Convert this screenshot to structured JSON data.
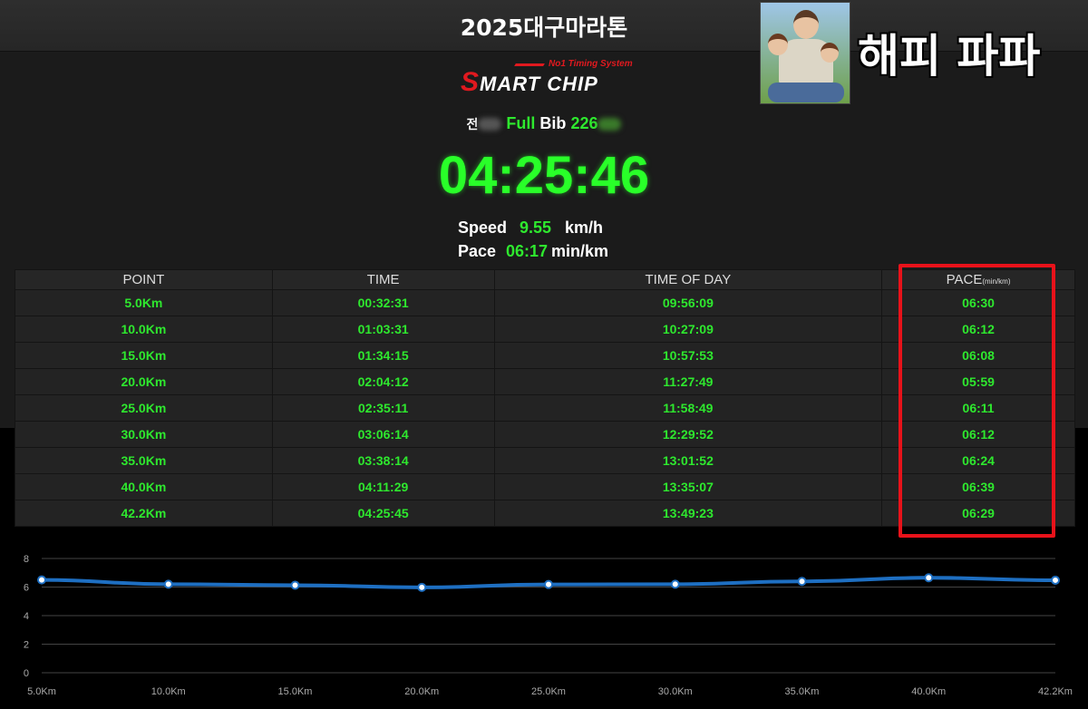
{
  "header": {
    "title": "2025대구마라톤"
  },
  "logo": {
    "tagline": "No1 Timing System",
    "brand_s": "S",
    "brand_rest": "MART CHIP"
  },
  "runner": {
    "name_visible": "전",
    "category": "Full",
    "bib_label": "Bib",
    "bib_visible": "226"
  },
  "result": {
    "finish_time": "04:25:46"
  },
  "stats": {
    "speed_label": "Speed",
    "speed_value": "9.55",
    "speed_unit": "km/h",
    "pace_label": "Pace",
    "pace_value": "06:17",
    "pace_unit": "min/km"
  },
  "splits": {
    "headers": [
      "POINT",
      "TIME",
      "TIME OF DAY",
      "PACE"
    ],
    "pace_unit_small": "(min/km)",
    "rows": [
      [
        "5.0Km",
        "00:32:31",
        "09:56:09",
        "06:30"
      ],
      [
        "10.0Km",
        "01:03:31",
        "10:27:09",
        "06:12"
      ],
      [
        "15.0Km",
        "01:34:15",
        "10:57:53",
        "06:08"
      ],
      [
        "20.0Km",
        "02:04:12",
        "11:27:49",
        "05:59"
      ],
      [
        "25.0Km",
        "02:35:11",
        "11:58:49",
        "06:11"
      ],
      [
        "30.0Km",
        "03:06:14",
        "12:29:52",
        "06:12"
      ],
      [
        "35.0Km",
        "03:38:14",
        "13:01:52",
        "06:24"
      ],
      [
        "40.0Km",
        "04:11:29",
        "13:35:07",
        "06:39"
      ],
      [
        "42.2Km",
        "04:25:45",
        "13:49:23",
        "06:29"
      ]
    ]
  },
  "chart_data": {
    "type": "line",
    "categories": [
      "5.0Km",
      "10.0Km",
      "15.0Km",
      "20.0Km",
      "25.0Km",
      "30.0Km",
      "35.0Km",
      "40.0Km",
      "42.2Km"
    ],
    "series": [
      {
        "values": [
          6.5,
          6.2,
          6.13,
          5.98,
          6.18,
          6.2,
          6.4,
          6.65,
          6.48
        ]
      }
    ],
    "y_ticks": [
      "0",
      "2",
      "4",
      "6",
      "8"
    ],
    "ylim": [
      0,
      8
    ],
    "grid": true,
    "line_color": "#1e6fc2"
  },
  "watermark": {
    "text": "해피 파파"
  },
  "colors": {
    "accent_green": "#2ee82e",
    "highlight_red": "#e8121a"
  }
}
